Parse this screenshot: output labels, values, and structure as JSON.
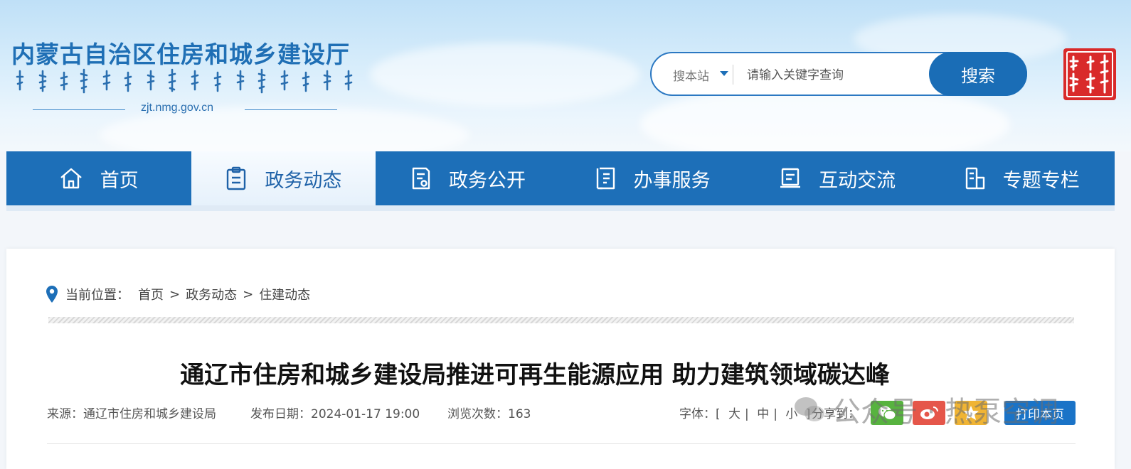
{
  "header": {
    "site_title": "内蒙古自治区住房和城乡建设厅",
    "domain": "zjt.nmg.gov.cn",
    "search": {
      "scope": "搜本站",
      "placeholder": "请输入关键字查询",
      "button": "搜索"
    }
  },
  "nav": {
    "items": [
      {
        "label": "首页",
        "icon": "home-icon"
      },
      {
        "label": "政务动态",
        "icon": "clipboard-icon"
      },
      {
        "label": "政务公开",
        "icon": "document-icon"
      },
      {
        "label": "办事服务",
        "icon": "service-icon"
      },
      {
        "label": "互动交流",
        "icon": "book-icon"
      },
      {
        "label": "专题专栏",
        "icon": "column-icon"
      }
    ],
    "active_index": 1
  },
  "breadcrumb": {
    "label": "当前位置：",
    "items": [
      "首页",
      "政务动态",
      "住建动态"
    ],
    "separator": ">"
  },
  "article": {
    "title": "通辽市住房和城乡建设局推进可再生能源应用 助力建筑领域碳达峰",
    "source": "来源：通辽市住房和城乡建设局",
    "date": "发布日期：2024-01-17 19:00",
    "views": "浏览次数：163"
  },
  "tools": {
    "font_label": "字体：[",
    "font_sizes": [
      "大",
      "中",
      "小"
    ],
    "font_end": "]",
    "share_label": "分享到：",
    "print": "打印本页"
  },
  "watermark": "公众号 · 热泵空调",
  "colors": {
    "primary": "#1d6fb8",
    "title_blue": "#1f6fb5",
    "wechat": "#57b33f",
    "weibo": "#e5564a",
    "qzone": "#f0b434"
  }
}
